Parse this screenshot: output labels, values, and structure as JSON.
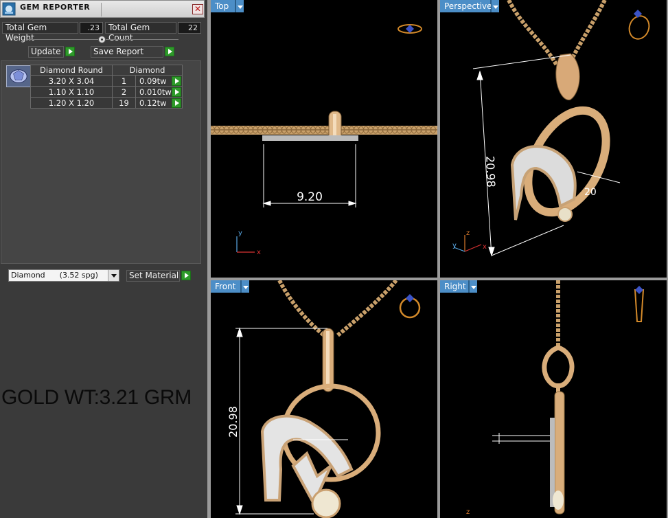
{
  "window": {
    "title": "GEM REPORTER",
    "close_label": "✕"
  },
  "stats": {
    "total_weight_label": "Total Gem Weight",
    "total_weight_value": ".23",
    "total_count_label": "Total Gem Count",
    "total_count_value": "22"
  },
  "actions": {
    "update_label": "Update",
    "save_label": "Save Report"
  },
  "gem_table": {
    "headers": [
      "Diamond Round",
      "Diamond"
    ],
    "rows": [
      {
        "size": "3.20 X 3.04",
        "count": "1",
        "weight": "0.09tw"
      },
      {
        "size": "1.10 X 1.10",
        "count": "2",
        "weight": "0.010tw"
      },
      {
        "size": "1.20 X 1.20",
        "count": "19",
        "weight": "0.12tw"
      }
    ]
  },
  "material": {
    "selected": "Diamond      (3.52 spg)",
    "set_label": "Set Material"
  },
  "overlay": {
    "gold_weight": "GOLD WT:3.21 GRM"
  },
  "viewports": {
    "top": {
      "label": "Top",
      "dimension": "9.20"
    },
    "perspective": {
      "label": "Perspective",
      "dimension_height": "20.98",
      "dimension_width": "20"
    },
    "front": {
      "label": "Front",
      "dimension": "20.98"
    },
    "right": {
      "label": "Right"
    }
  },
  "axes": {
    "x": "x",
    "y": "y",
    "z": "z"
  },
  "colors": {
    "gold": "#d9b07a",
    "viewport_tab": "#4c8ec7",
    "go_button": "#2e9a2a"
  }
}
